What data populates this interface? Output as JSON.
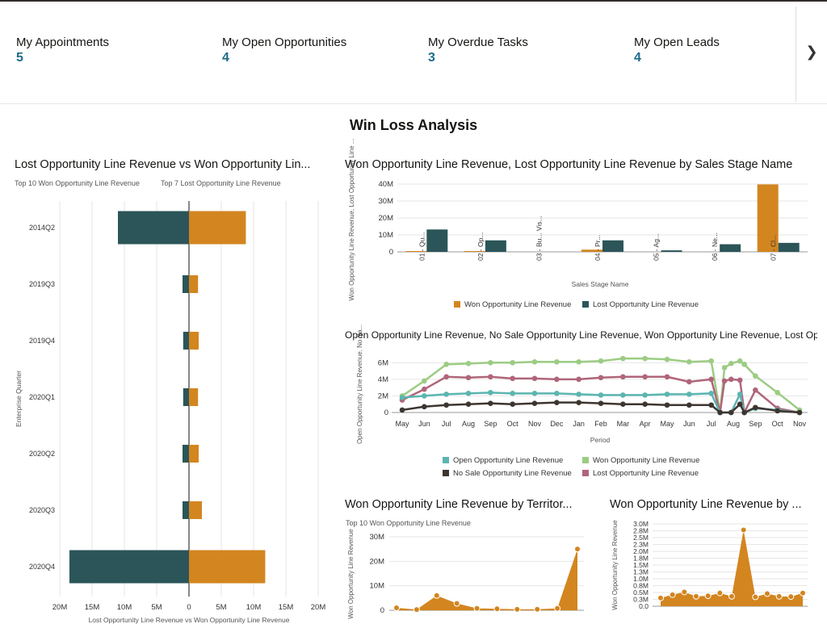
{
  "kpis": [
    {
      "label": "My Appointments",
      "value": "5"
    },
    {
      "label": "My Open Opportunities",
      "value": "4"
    },
    {
      "label": "My Overdue Tasks",
      "value": "3"
    },
    {
      "label": "My Open Leads",
      "value": "4"
    }
  ],
  "icons": {
    "next": "chevron-right-icon"
  },
  "page_title": "Win Loss Analysis",
  "colors": {
    "won": "#d3851f",
    "lost": "#2b5558",
    "open": "#5bb5b0",
    "won_line": "#9ccc83",
    "nosale": "#3d3530",
    "lost_line": "#b0657a"
  },
  "chart_data": [
    {
      "type": "bar",
      "orientation": "horizontal-diverging",
      "title": "Lost Opportunity Line Revenue vs Won Opportunity Lin...",
      "subtitle_left": "Top 10 Won Opportunity Line Revenue",
      "subtitle_right": "Top 7 Lost Opportunity Line Revenue",
      "ylabel": "Enterprise Quarter",
      "xlabel": "Lost Opportunity Line Revenue vs Won Opportunity Line Revenue",
      "categories": [
        "2014Q2",
        "2019Q3",
        "2019Q4",
        "2020Q1",
        "2020Q2",
        "2020Q3",
        "2020Q4"
      ],
      "series": [
        {
          "name": "Lost Opportunity Line Revenue",
          "values": [
            11000000,
            1000000,
            900000,
            900000,
            1000000,
            1000000,
            18500000
          ]
        },
        {
          "name": "Won Opportunity Line Revenue",
          "values": [
            8800000,
            1400000,
            1500000,
            1400000,
            1500000,
            2000000,
            11800000
          ]
        }
      ],
      "x_ticks": [
        "20M",
        "15M",
        "10M",
        "5M",
        "0",
        "5M",
        "10M",
        "15M",
        "20M"
      ],
      "xlim": [
        -20000000,
        20000000
      ]
    },
    {
      "type": "bar",
      "title": "Won Opportunity Line Revenue, Lost Opportunity Line Revenue by Sales Stage Name",
      "xlabel": "Sales Stage Name",
      "ylabel": "Won Opportunity Line Revenue, Lost Opportunity Line ...",
      "categories": [
        "01 - Qu...",
        "02 - Op...",
        "03 - Bu... Vis...",
        "04 - Pr...",
        "05 - Ag...",
        "06 - Ne...",
        "07 - Cl..."
      ],
      "series": [
        {
          "name": "Won Opportunity Line Revenue",
          "values": [
            300000,
            400000,
            0,
            1300000,
            0,
            0,
            39800000
          ]
        },
        {
          "name": "Lost Opportunity Line Revenue",
          "values": [
            13200000,
            6800000,
            0,
            6800000,
            900000,
            4500000,
            5300000
          ]
        }
      ],
      "y_ticks": [
        "0",
        "10M",
        "20M",
        "30M",
        "40M"
      ],
      "ylim": [
        0,
        40000000
      ],
      "legend": "bottom"
    },
    {
      "type": "line",
      "title": "Open Opportunity Line Revenue, No Sale Opportunity Line Revenue, Won Opportunity Line Revenue, Lost Op...",
      "xlabel": "Period",
      "ylabel": "Open Opportunity Line Revenue, No Sa...",
      "x": [
        "May",
        "Jun",
        "Jul",
        "Aug",
        "Sep",
        "Oct",
        "Nov",
        "Dec",
        "Jan",
        "Feb",
        "Mar",
        "Apr",
        "May",
        "Jun",
        "Jul",
        "Aug",
        "Sep",
        "Oct",
        "Nov"
      ],
      "y_ticks": [
        "0",
        "2M",
        "4M",
        "6M"
      ],
      "ylim": [
        0,
        7000000
      ],
      "series": [
        {
          "name": "Open Opportunity Line Revenue",
          "points": [
            [
              0,
              1800000
            ],
            [
              1,
              2000000
            ],
            [
              2,
              2200000
            ],
            [
              3,
              2300000
            ],
            [
              4,
              2400000
            ],
            [
              5,
              2300000
            ],
            [
              6,
              2300000
            ],
            [
              7,
              2300000
            ],
            [
              8,
              2200000
            ],
            [
              9,
              2100000
            ],
            [
              10,
              2100000
            ],
            [
              11,
              2100000
            ],
            [
              12,
              2200000
            ],
            [
              13,
              2200000
            ],
            [
              14,
              2300000
            ],
            [
              14.4,
              0
            ],
            [
              14.9,
              0
            ],
            [
              15.3,
              2200000
            ],
            [
              15.5,
              0
            ],
            [
              16,
              500000
            ],
            [
              17,
              300000
            ],
            [
              18,
              0
            ]
          ]
        },
        {
          "name": "Won Opportunity Line Revenue",
          "points": [
            [
              0,
              2000000
            ],
            [
              1,
              3800000
            ],
            [
              2,
              5800000
            ],
            [
              3,
              5900000
            ],
            [
              4,
              6000000
            ],
            [
              5,
              6000000
            ],
            [
              6,
              6100000
            ],
            [
              7,
              6100000
            ],
            [
              8,
              6100000
            ],
            [
              9,
              6200000
            ],
            [
              10,
              6500000
            ],
            [
              11,
              6500000
            ],
            [
              12,
              6400000
            ],
            [
              13,
              6100000
            ],
            [
              14,
              6200000
            ],
            [
              14.4,
              0
            ],
            [
              14.6,
              5400000
            ],
            [
              14.9,
              5900000
            ],
            [
              15.3,
              6200000
            ],
            [
              15.5,
              5800000
            ],
            [
              16,
              4400000
            ],
            [
              17,
              2400000
            ],
            [
              18,
              300000
            ]
          ]
        },
        {
          "name": "No Sale Opportunity Line Revenue",
          "points": [
            [
              0,
              300000
            ],
            [
              1,
              700000
            ],
            [
              2,
              900000
            ],
            [
              3,
              1000000
            ],
            [
              4,
              1100000
            ],
            [
              5,
              1000000
            ],
            [
              6,
              1100000
            ],
            [
              7,
              1200000
            ],
            [
              8,
              1200000
            ],
            [
              9,
              1100000
            ],
            [
              10,
              1000000
            ],
            [
              11,
              1000000
            ],
            [
              12,
              900000
            ],
            [
              13,
              900000
            ],
            [
              14,
              900000
            ],
            [
              14.4,
              0
            ],
            [
              14.9,
              0
            ],
            [
              15.3,
              1000000
            ],
            [
              15.5,
              0
            ],
            [
              16,
              600000
            ],
            [
              17,
              200000
            ],
            [
              18,
              0
            ]
          ]
        },
        {
          "name": "Lost Opportunity Line Revenue",
          "points": [
            [
              0,
              1500000
            ],
            [
              1,
              2800000
            ],
            [
              2,
              4300000
            ],
            [
              3,
              4200000
            ],
            [
              4,
              4300000
            ],
            [
              5,
              4100000
            ],
            [
              6,
              4100000
            ],
            [
              7,
              4000000
            ],
            [
              8,
              4000000
            ],
            [
              9,
              4200000
            ],
            [
              10,
              4300000
            ],
            [
              11,
              4300000
            ],
            [
              12,
              4300000
            ],
            [
              13,
              3700000
            ],
            [
              14,
              4000000
            ],
            [
              14.4,
              0
            ],
            [
              14.6,
              3800000
            ],
            [
              14.9,
              4000000
            ],
            [
              15.3,
              3900000
            ],
            [
              15.5,
              0
            ],
            [
              16,
              2700000
            ],
            [
              17,
              500000
            ],
            [
              18,
              0
            ]
          ]
        }
      ],
      "legend": "bottom"
    },
    {
      "type": "area",
      "title": "Won Opportunity Line Revenue by Territor...",
      "subtitle": "Top 10 Won Opportunity Line Revenue",
      "ylabel": "Won Opportunity Line Revenue",
      "values": [
        1000000,
        300000,
        6000000,
        2800000,
        800000,
        600000,
        400000,
        400000,
        800000,
        25000000
      ],
      "y_ticks": [
        "0",
        "10M",
        "20M",
        "30M"
      ],
      "ylim": [
        0,
        30000000
      ]
    },
    {
      "type": "area",
      "title": "Won Opportunity Line Revenue by ...",
      "ylabel": "Won Opportunity Line Revenue",
      "values": [
        300000,
        420000,
        520000,
        360000,
        380000,
        480000,
        360000,
        2780000,
        340000,
        460000,
        360000,
        350000,
        480000
      ],
      "y_ticks": [
        "0.0",
        "0.3M",
        "0.5M",
        "0.8M",
        "1.0M",
        "1.3M",
        "1.5M",
        "1.8M",
        "2.0M",
        "2.3M",
        "2.5M",
        "2.8M",
        "3.0M"
      ],
      "ylim": [
        0,
        3000000
      ]
    }
  ]
}
